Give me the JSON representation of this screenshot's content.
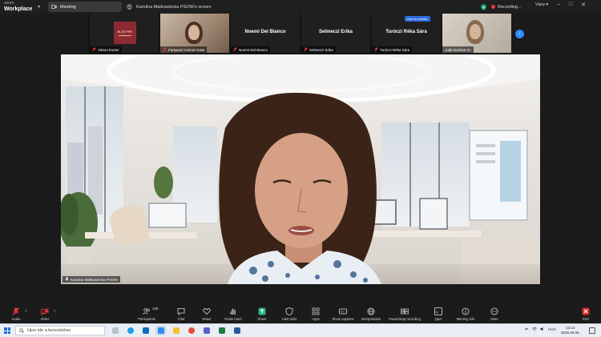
{
  "titlebar": {
    "brand_small": "zoom",
    "brand_name": "Workplace",
    "meeting_tab": "Meeting",
    "screen_owner": "Karolina Malkowiecka PSONI's screen",
    "recording_label": "Recording...",
    "view_label": "View"
  },
  "gallery": {
    "tiles": [
      {
        "name": "Vámei Eszter",
        "logo_text": "ELTE PPK"
      },
      {
        "name": "Farkasné Gömöri Kata"
      },
      {
        "name": "Noemi Del Bianco",
        "display": "Noemi Del Bianco"
      },
      {
        "name": "Selmeczi Erika",
        "display": "Selmeczi Erika"
      },
      {
        "name": "Turóczi Réka Sára",
        "display": "Turóczi Réka Sára"
      },
      {
        "name": "Judit Dombai Dr."
      }
    ],
    "chip": "Ask to unmute"
  },
  "main_video": {
    "speaker_name": "Karolina Malkowiecka PSONI"
  },
  "toolbar": {
    "audio": "Audio",
    "video": "Video",
    "participants": "Participants",
    "participants_count": "126",
    "chat": "Chat",
    "react": "React",
    "raise_hand": "Raise hand",
    "share": "Share",
    "host_tools": "Host tools",
    "apps": "Apps",
    "show_captions": "Show captions",
    "interpretation": "Interpretation",
    "pause_recording": "Pause/stop recording",
    "qa": "Q&A",
    "meeting_info": "Meeting info",
    "more": "More",
    "end": "End"
  },
  "taskbar": {
    "search_placeholder": "Ujon ide a kereséshez",
    "tray_lang": "HUN",
    "time": "12:14",
    "date": "2025.06.05."
  },
  "colors": {
    "zoom_blue": "#2d8cff",
    "record_red": "#e8383d",
    "share_green": "#24b47e",
    "end_red": "#e02828",
    "logo_maroon": "#8c2b33"
  }
}
